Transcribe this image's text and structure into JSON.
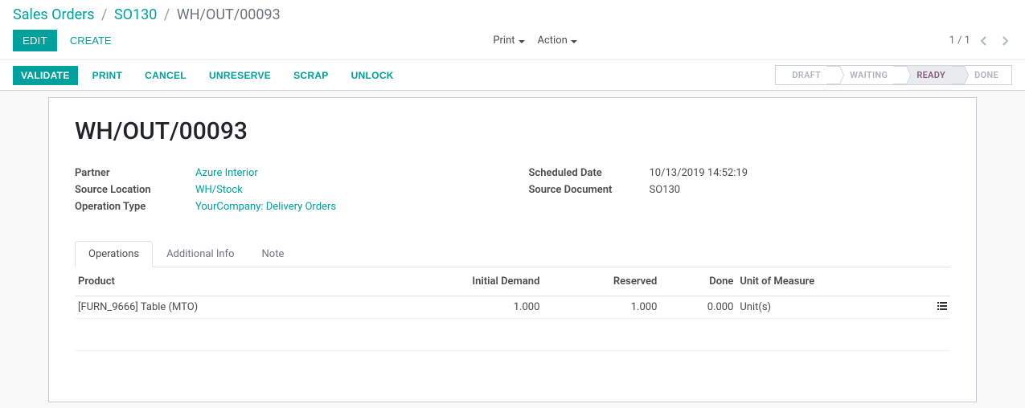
{
  "breadcrumb": {
    "root": "Sales Orders",
    "parent": "SO130",
    "current": "WH/OUT/00093"
  },
  "controls": {
    "edit": "EDIT",
    "create": "CREATE",
    "print": "Print",
    "action": "Action",
    "pager": "1 / 1"
  },
  "actions": {
    "validate": "VALIDATE",
    "print": "PRINT",
    "cancel": "CANCEL",
    "unreserve": "UNRESERVE",
    "scrap": "SCRAP",
    "unlock": "UNLOCK"
  },
  "status": {
    "draft": "DRAFT",
    "waiting": "WAITING",
    "ready": "READY",
    "done": "DONE",
    "active": "ready"
  },
  "record": {
    "title": "WH/OUT/00093",
    "partner_label": "Partner",
    "partner": "Azure Interior",
    "source_location_label": "Source Location",
    "source_location": "WH/Stock",
    "operation_type_label": "Operation Type",
    "operation_type": "YourCompany: Delivery Orders",
    "scheduled_date_label": "Scheduled Date",
    "scheduled_date": "10/13/2019 14:52:19",
    "source_document_label": "Source Document",
    "source_document": "SO130"
  },
  "tabs": {
    "operations": "Operations",
    "additional_info": "Additional Info",
    "note": "Note"
  },
  "table": {
    "headers": {
      "product": "Product",
      "initial_demand": "Initial Demand",
      "reserved": "Reserved",
      "done": "Done",
      "uom": "Unit of Measure"
    },
    "rows": [
      {
        "product": "[FURN_9666] Table (MTO)",
        "initial_demand": "1.000",
        "reserved": "1.000",
        "done": "0.000",
        "uom": "Unit(s)"
      }
    ]
  }
}
